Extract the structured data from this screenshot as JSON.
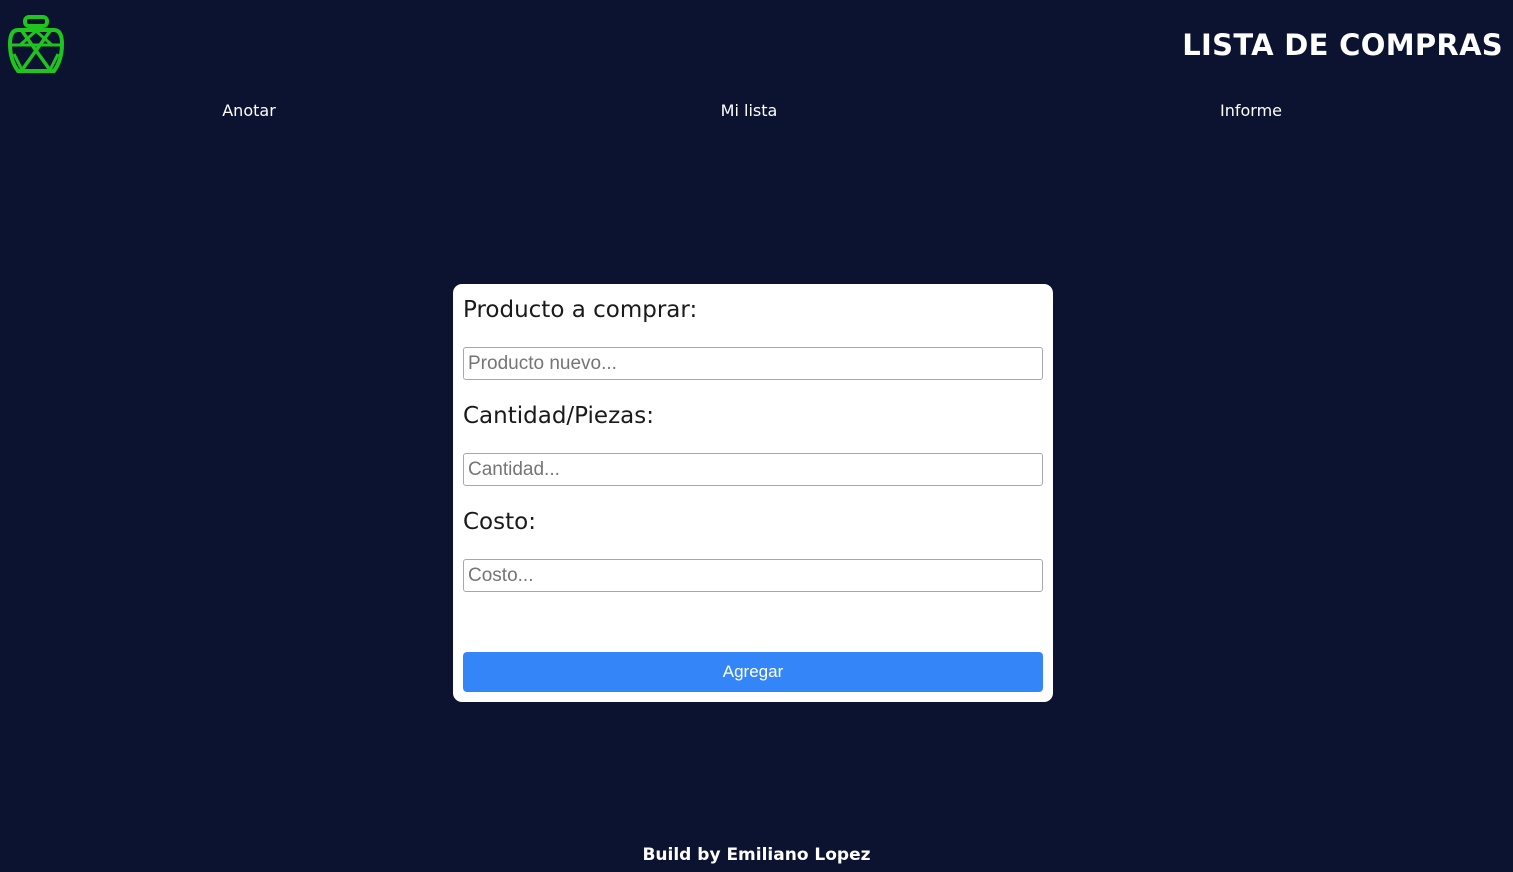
{
  "header": {
    "logo_icon": "basket-icon",
    "logo_color": "#1fc41f",
    "title": "LISTA DE COMPRAS"
  },
  "nav": {
    "items": [
      {
        "label": "Anotar"
      },
      {
        "label": "Mi lista"
      },
      {
        "label": "Informe"
      }
    ]
  },
  "form": {
    "product": {
      "label": "Producto a comprar:",
      "placeholder": "Producto nuevo...",
      "value": ""
    },
    "quantity": {
      "label": "Cantidad/Piezas:",
      "placeholder": "Cantidad...",
      "value": ""
    },
    "cost": {
      "label": "Costo:",
      "placeholder": "Costo...",
      "value": ""
    },
    "submit_label": "Agregar"
  },
  "footer": {
    "text": "Build by Emiliano Lopez"
  },
  "colors": {
    "background": "#0b1330",
    "card": "#ffffff",
    "button": "#3486f8",
    "logo": "#1fc41f"
  }
}
